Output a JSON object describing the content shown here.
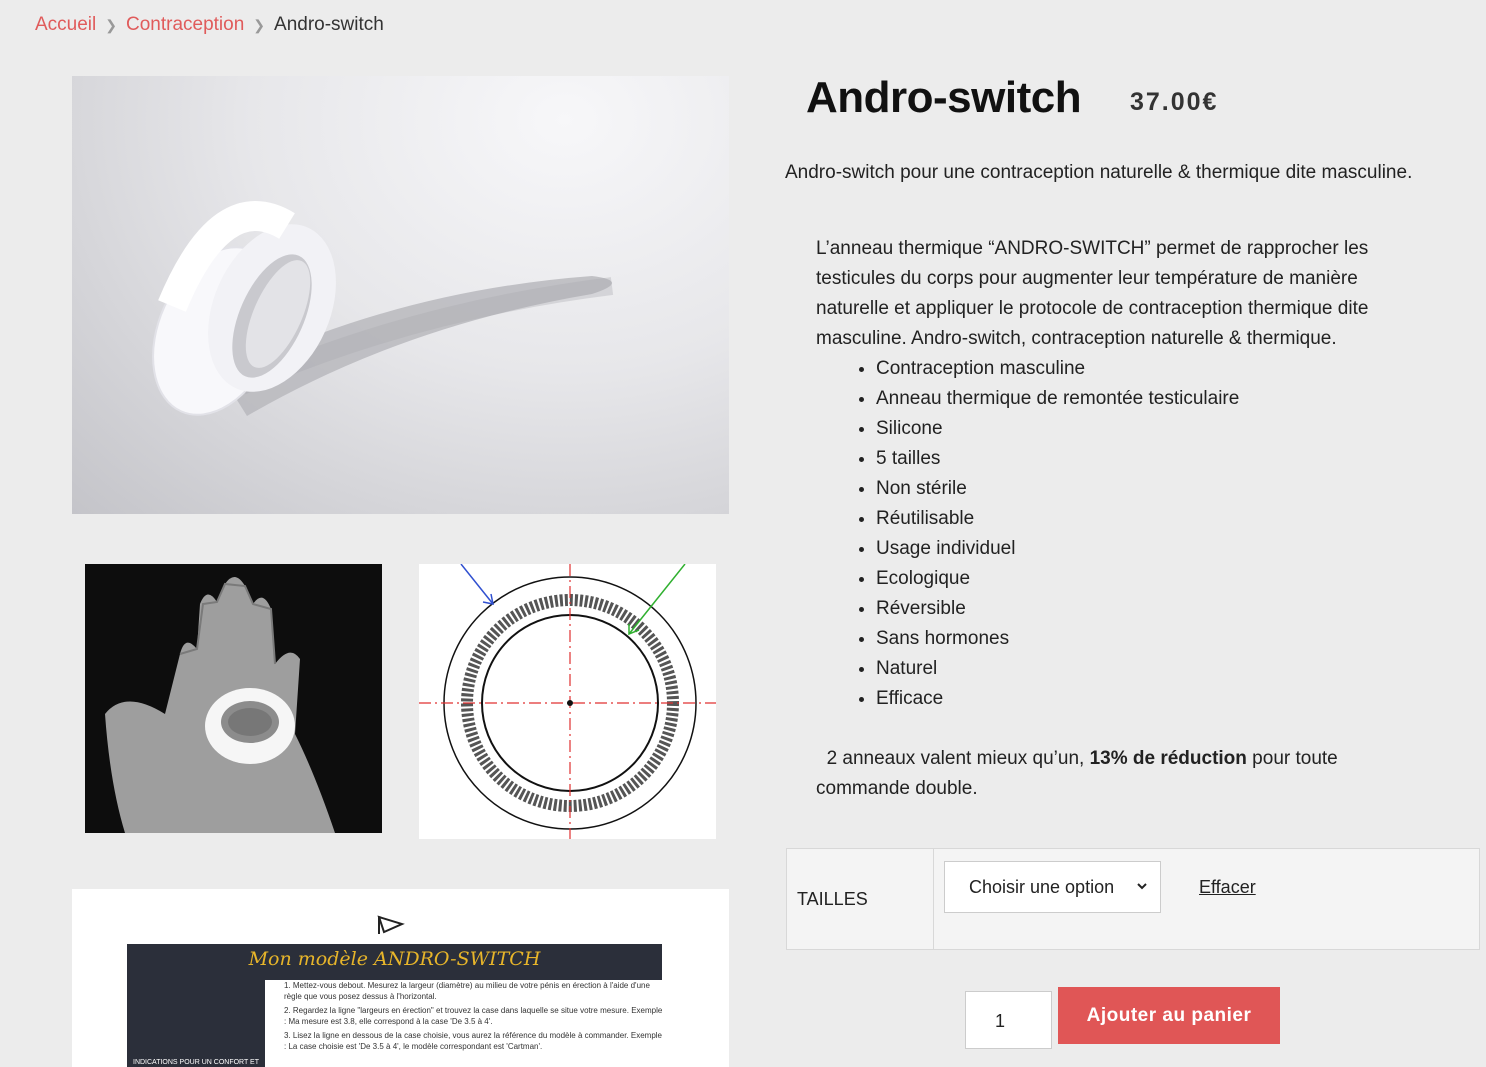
{
  "breadcrumb": {
    "home": "Accueil",
    "category": "Contraception",
    "current": "Andro-switch",
    "separator_icon": "chevron-right-icon"
  },
  "product": {
    "title": "Andro-switch",
    "price": "37.00€",
    "short_description": "Andro-switch pour une contraception naturelle & thermique dite masculine.",
    "description": "L’anneau thermique “ANDRO-SWITCH” permet de rapprocher les testicules du corps pour augmenter leur température de manière naturelle et appliquer le protocole de contraception thermique dite masculine. Andro-switch, contraception naturelle & thermique.",
    "features": [
      "Contraception masculine",
      "Anneau thermique de remontée testiculaire",
      "Silicone",
      "5 tailles",
      "Non stérile",
      "Réutilisable",
      "Usage individuel",
      "Ecologique",
      "Réversible",
      "Sans hormones",
      "Naturel",
      "Efficace"
    ],
    "promo": {
      "before": "2 anneaux valent mieux qu’un, ",
      "highlight": "13% de réduction",
      "after": " pour toute commande double."
    }
  },
  "variations": {
    "label": "TAILLES",
    "select_value": "Choisir une option",
    "reset_label": "Effacer"
  },
  "cart": {
    "quantity": "1",
    "add_label": "Ajouter au panier"
  },
  "gallery": {
    "doc_title": "Mon modèle ANDRO-SWITCH",
    "doc_side": "INDICATIONS POUR UN CONFORT ET",
    "doc_lines": [
      "1.  Mettez-vous debout. Mesurez la largeur (diamètre) au milieu de votre pénis en érection à l'aide d'une règle que vous posez dessus à l'horizontal.",
      "2.  Regardez la ligne \"largeurs en érection\" et trouvez la case dans laquelle se situe votre mesure. Exemple : Ma mesure est 3.8, elle correspond à la case 'De 3.5 à 4'.",
      "3.  Lisez la ligne en dessous de la case choisie, vous aurez la référence du modèle à commander. Exemple : La case choisie est 'De 3.5 à 4', le modèle correspondant est 'Cartman'."
    ]
  },
  "colors": {
    "accent": "#e05656",
    "link": "#e05b5b",
    "background": "#ececec"
  }
}
